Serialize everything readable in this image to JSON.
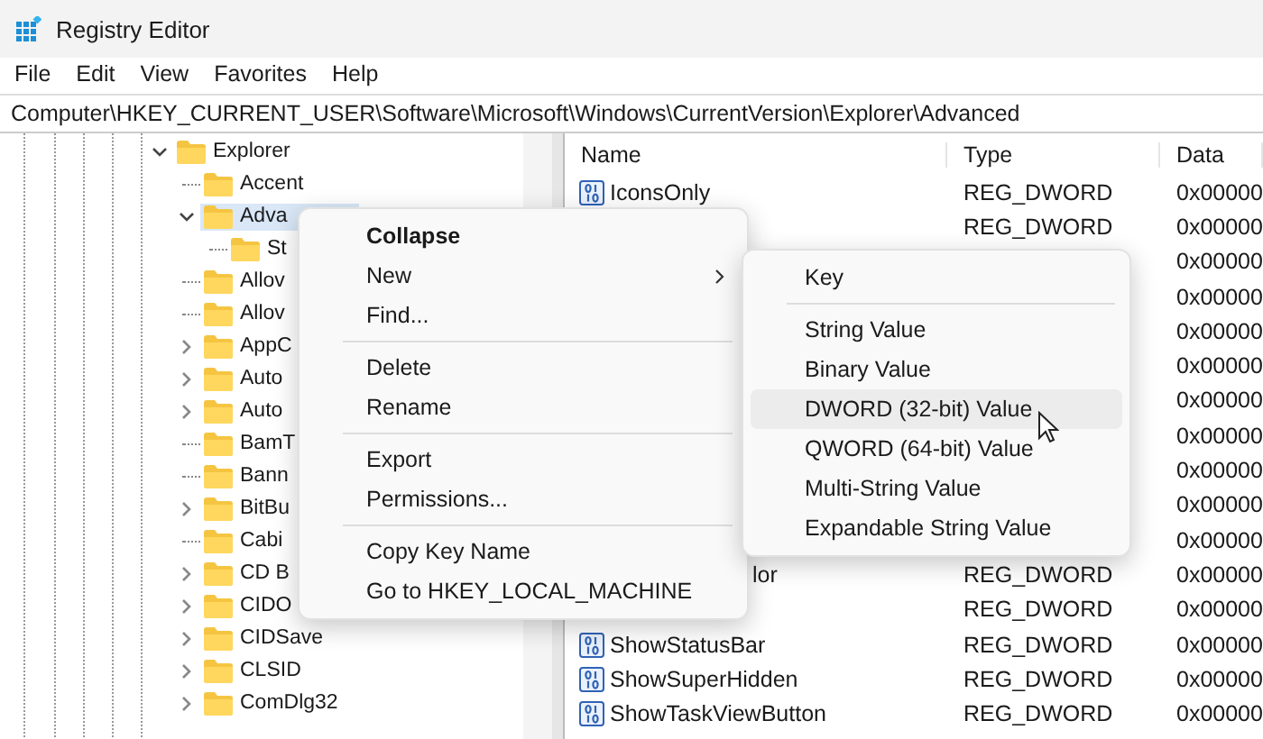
{
  "window": {
    "title": "Registry Editor"
  },
  "menu_bar": [
    "File",
    "Edit",
    "View",
    "Favorites",
    "Help"
  ],
  "address_bar": {
    "value": "Computer\\HKEY_CURRENT_USER\\Software\\Microsoft\\Windows\\CurrentVersion\\Explorer\\Advanced"
  },
  "tree": [
    {
      "label": "Explorer",
      "kind": "open",
      "selected": false,
      "children": [
        {
          "label": "Accent",
          "kind": "leaf",
          "selected": false
        },
        {
          "label": "Adva",
          "kind": "open",
          "selected": true,
          "children": [
            {
              "label": "St",
              "kind": "leaf",
              "selected": false
            }
          ]
        },
        {
          "label": "Allov",
          "kind": "leaf",
          "selected": false
        },
        {
          "label": "Allov",
          "kind": "leaf",
          "selected": false
        },
        {
          "label": "AppC",
          "kind": "closed",
          "selected": false
        },
        {
          "label": "Auto",
          "kind": "closed",
          "selected": false
        },
        {
          "label": "Auto",
          "kind": "closed",
          "selected": false
        },
        {
          "label": "BamT",
          "kind": "leaf",
          "selected": false
        },
        {
          "label": "Bann",
          "kind": "leaf",
          "selected": false
        },
        {
          "label": "BitBu",
          "kind": "closed",
          "selected": false
        },
        {
          "label": "Cabi",
          "kind": "leaf",
          "selected": false
        },
        {
          "label": "CD B",
          "kind": "closed",
          "selected": false
        },
        {
          "label": "CIDO",
          "kind": "closed",
          "selected": false
        },
        {
          "label": "CIDSave",
          "kind": "closed",
          "selected": false
        },
        {
          "label": "CLSID",
          "kind": "closed",
          "selected": false
        },
        {
          "label": "ComDlg32",
          "kind": "closed",
          "selected": false
        }
      ]
    }
  ],
  "values_list": {
    "columns": [
      "Name",
      "Type",
      "Data"
    ],
    "rows": [
      {
        "name": "IconsOnly",
        "clipped": false,
        "type": "REG_DWORD",
        "data": "0x00000"
      },
      {
        "type": "REG_DWORD",
        "data": "0x00000"
      },
      {
        "data": "0x00000"
      },
      {
        "data": "0x00000"
      },
      {
        "data": "0x00000"
      },
      {
        "data": "0x00000"
      },
      {
        "data": "0x00000"
      },
      {
        "data": "0x00000"
      },
      {
        "data": "0x00000"
      },
      {
        "data": "0x00000"
      },
      {
        "data": "0x00000"
      },
      {
        "name": "lor",
        "clipped": true,
        "type": "REG_DWORD",
        "data": "0x00000"
      },
      {
        "type": "REG_DWORD",
        "data": "0x00000"
      },
      {
        "name": "ShowStatusBar",
        "clipped": false,
        "type": "REG_DWORD",
        "data": "0x00000"
      },
      {
        "name": "ShowSuperHidden",
        "clipped": false,
        "type": "REG_DWORD",
        "data": "0x00000"
      },
      {
        "name": "ShowTaskViewButton",
        "clipped": false,
        "type": "REG_DWORD",
        "data": "0x00000"
      }
    ]
  },
  "context_menu": [
    {
      "kind": "item",
      "label": "Collapse",
      "default": true
    },
    {
      "kind": "submenu",
      "label": "New",
      "default": false
    },
    {
      "kind": "item",
      "label": "Find...",
      "default": false
    },
    {
      "kind": "separator"
    },
    {
      "kind": "item",
      "label": "Delete",
      "default": false
    },
    {
      "kind": "item",
      "label": "Rename",
      "default": false
    },
    {
      "kind": "separator"
    },
    {
      "kind": "item",
      "label": "Export",
      "default": false
    },
    {
      "kind": "item",
      "label": "Permissions...",
      "default": false
    },
    {
      "kind": "separator"
    },
    {
      "kind": "item",
      "label": "Copy Key Name",
      "default": false
    },
    {
      "kind": "item",
      "label": "Go to HKEY_LOCAL_MACHINE",
      "default": false
    }
  ],
  "submenu": [
    {
      "kind": "item",
      "label": "Key",
      "selected": false
    },
    {
      "kind": "separator"
    },
    {
      "kind": "item",
      "label": "String Value",
      "selected": false
    },
    {
      "kind": "item",
      "label": "Binary Value",
      "selected": false
    },
    {
      "kind": "item",
      "label": "DWORD (32-bit) Value",
      "selected": true
    },
    {
      "kind": "item",
      "label": "QWORD (64-bit) Value",
      "selected": false
    },
    {
      "kind": "item",
      "label": "Multi-String Value",
      "selected": false
    },
    {
      "kind": "item",
      "label": "Expandable String Value",
      "selected": false
    }
  ]
}
